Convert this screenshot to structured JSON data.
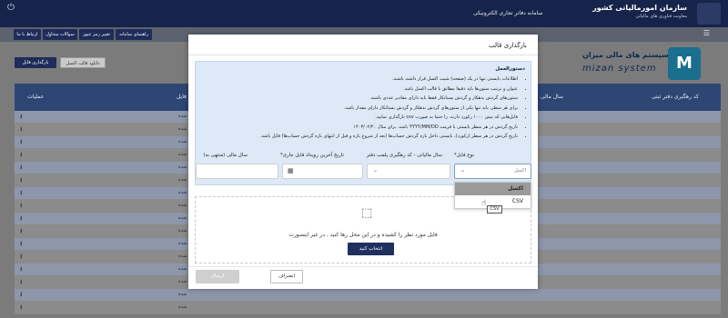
{
  "banner": {
    "org_name": "سازمان امورمالیاتی کشور",
    "org_sub": "معاونت فناوری های مالیاتی",
    "system_name": "سامانه دفاتر تجاری الکترونیکی"
  },
  "menu": {
    "items": [
      "ارتباط با ما",
      "سوالات متداول",
      "تغییر رمز عبور",
      "راهنمای سامانه"
    ]
  },
  "brand": {
    "fa": "سیستم های مالی میزان",
    "en": "mizan system"
  },
  "page_buttons": {
    "download_template": "دانلود قالب اکسل",
    "upload_file": "بارگذاری فایل"
  },
  "grid": {
    "headers": {
      "tracking": "کد رهگیری دفتر ثبتی",
      "fiscal_year": "سال مالی",
      "file": "فایل",
      "operations": "عملیات"
    },
    "rows": [
      {
        "status": "شده"
      },
      {
        "status": "شده"
      },
      {
        "status": "شده"
      },
      {
        "status": "شده"
      },
      {
        "status": "شده"
      },
      {
        "status": "شده"
      },
      {
        "status": "شده"
      },
      {
        "status": "شده"
      },
      {
        "status": "شده"
      },
      {
        "status": "شده"
      },
      {
        "status": "شده"
      },
      {
        "status": "شده"
      },
      {
        "status": "شده"
      },
      {
        "status": "شده"
      },
      {
        "status": "شده"
      },
      {
        "status": "شده"
      }
    ]
  },
  "modal": {
    "title": "بارگذاری قالب",
    "guide_title": "دستورالعمل",
    "guide_items": [
      "اطلاعات بایستی تنها در یک (صفحه) شیت اکسل قرار داشته باشند.",
      "عنوان و ترتیب ستون‌ها باید دقیقا مطابق با قالب اکسل باشد.",
      "ستون‌های گردش بدهکار و گردش بستانکار فقط باید دارای مقادیر عددی باشند.",
      "برای هر سطر، باید تنها یکی از ستون‌های گردش بدهکار و گردش بستانکار دارای مقدار باشد.",
      "فایل‌هایی که بیش ۱۰۰۰ رکورد دارند، را حتما به صورت csv بارگذاری نمایید.",
      "تاریخ گردش در هر سطر بایستی با فرمت YYYY/MM/DD باشد. برای مثال ۱۴۰۳/۰۲/۲۰",
      "تاریخ گردش در هر سطر (رکورد)، بایستی داخل بازه گردش حساب‌ها (بعد از شروع بازه و قبل از انتهای بازه گردش حساب‌ها) فایل باشد."
    ],
    "fields": {
      "file_type_label": "نوع فایل*",
      "file_type_value": "اکسل",
      "fiscal_label": "سال مالیاتی - کد رهگیری پلمب دفتر",
      "last_date_label": "تاریخ آخرین رویداد فایل جاری*",
      "year_end_label": "سال مالی (منتهی به)"
    },
    "dropdown_options": [
      "اکسل",
      "CSV"
    ],
    "tooltip": "CSV",
    "dropzone_text": "فایل مورد نظر را کشیده و در این محل رها کنید . در غیر اینصورت",
    "choose_button": "انتخاب کنید",
    "cancel_button": "انصراف",
    "send_button": "ارسال"
  }
}
